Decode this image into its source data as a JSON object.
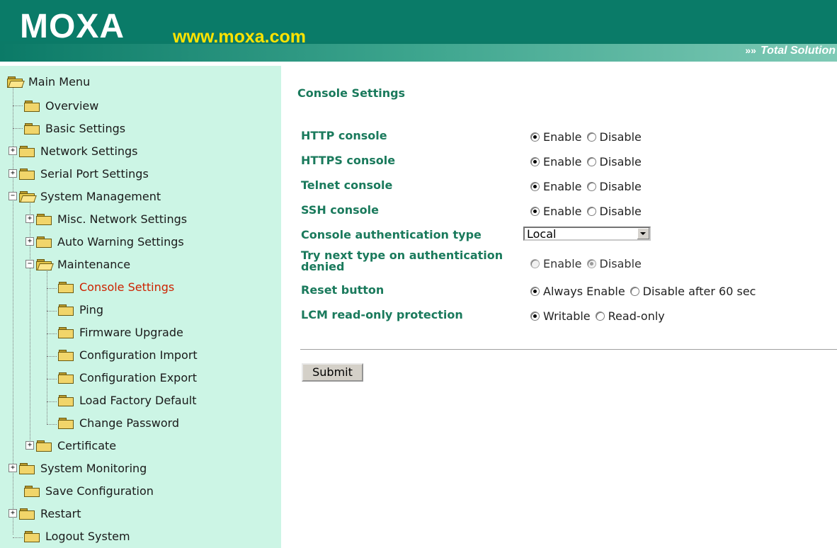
{
  "header": {
    "logo": "MOXA",
    "url": "www.moxa.com",
    "arrows": "»»",
    "tagline": "Total Solution"
  },
  "sidebar": {
    "items": [
      {
        "label": "Main Menu"
      },
      {
        "label": "Overview"
      },
      {
        "label": "Basic Settings"
      },
      {
        "label": "Network Settings"
      },
      {
        "label": "Serial Port Settings"
      },
      {
        "label": "System Management"
      },
      {
        "label": "Misc. Network Settings"
      },
      {
        "label": "Auto Warning Settings"
      },
      {
        "label": "Maintenance"
      },
      {
        "label": "Console Settings"
      },
      {
        "label": "Ping"
      },
      {
        "label": "Firmware Upgrade"
      },
      {
        "label": "Configuration Import"
      },
      {
        "label": "Configuration Export"
      },
      {
        "label": "Load Factory Default"
      },
      {
        "label": "Change Password"
      },
      {
        "label": "Certificate"
      },
      {
        "label": "System Monitoring"
      },
      {
        "label": "Save Configuration"
      },
      {
        "label": "Restart"
      },
      {
        "label": "Logout System"
      }
    ],
    "expanders": {
      "plus": "+",
      "minus": "−"
    },
    "active_item": "Console Settings"
  },
  "main": {
    "title": "Console Settings",
    "fields": {
      "http": {
        "label": "HTTP console",
        "opt1": "Enable",
        "opt2": "Disable",
        "selected": "Enable"
      },
      "https": {
        "label": "HTTPS console",
        "opt1": "Enable",
        "opt2": "Disable",
        "selected": "Enable"
      },
      "telnet": {
        "label": "Telnet console",
        "opt1": "Enable",
        "opt2": "Disable",
        "selected": "Enable"
      },
      "ssh": {
        "label": "SSH console",
        "opt1": "Enable",
        "opt2": "Disable",
        "selected": "Enable"
      },
      "auth_type": {
        "label": "Console authentication type",
        "value": "Local"
      },
      "try_next": {
        "label_line1": "Try next type on authentication",
        "label_line2": "denied",
        "opt1": "Enable",
        "opt2": "Disable",
        "selected": "Disable",
        "disabled": true
      },
      "reset": {
        "label": "Reset button",
        "opt1": "Always Enable",
        "opt2": "Disable after 60 sec",
        "selected": "Always Enable"
      },
      "lcm": {
        "label": "LCM read-only protection",
        "opt1": "Writable",
        "opt2": "Read-only",
        "selected": "Writable"
      }
    },
    "submit_label": "Submit"
  },
  "colors": {
    "header_green": "#0a7b68",
    "logo_yellow": "#ffe300",
    "sidebar_bg": "#ccf5e5",
    "label_green": "#1a7a5c",
    "active_red": "#cc2200"
  }
}
